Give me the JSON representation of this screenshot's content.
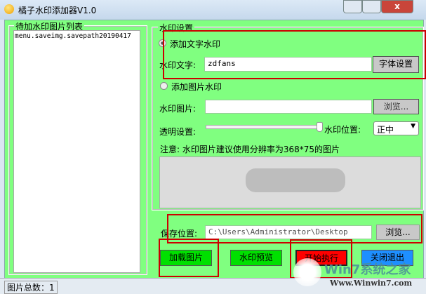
{
  "window": {
    "title": "橘子水印添加器V1.0"
  },
  "left": {
    "group_title": "待加水印图片列表",
    "items": [
      "menu.saveimg.savepath20190417"
    ]
  },
  "right": {
    "group_title": "水印设置",
    "text_radio": "添加文字水印",
    "text_label": "水印文字:",
    "text_value": "zdfans",
    "font_button": "字体设置",
    "image_radio": "添加图片水印",
    "image_label": "水印图片:",
    "image_value": "",
    "browse_button": "浏览...",
    "opacity_label": "透明设置:",
    "opacity_value": 1.0,
    "position_label": "水印位置:",
    "position_value": "正中",
    "note": "注意: 水印图片建议使用分辨率为368*75的图片",
    "save_label": "保存位置:",
    "save_value": "C:\\Users\\Administrator\\Desktop",
    "save_browse_button": "浏览..."
  },
  "buttons": {
    "load": "加载图片",
    "preview": "水印预览",
    "start": "开始执行",
    "exit": "关闭退出"
  },
  "status": {
    "text": "图片总数：1"
  },
  "watermark": {
    "brand": "Win7系统之家",
    "url": "Www.Winwin7.com"
  },
  "colors": {
    "bg": "#80ff80",
    "load": "#00e000",
    "preview": "#00e000",
    "start": "#ff0000",
    "exit": "#1e8fff"
  }
}
